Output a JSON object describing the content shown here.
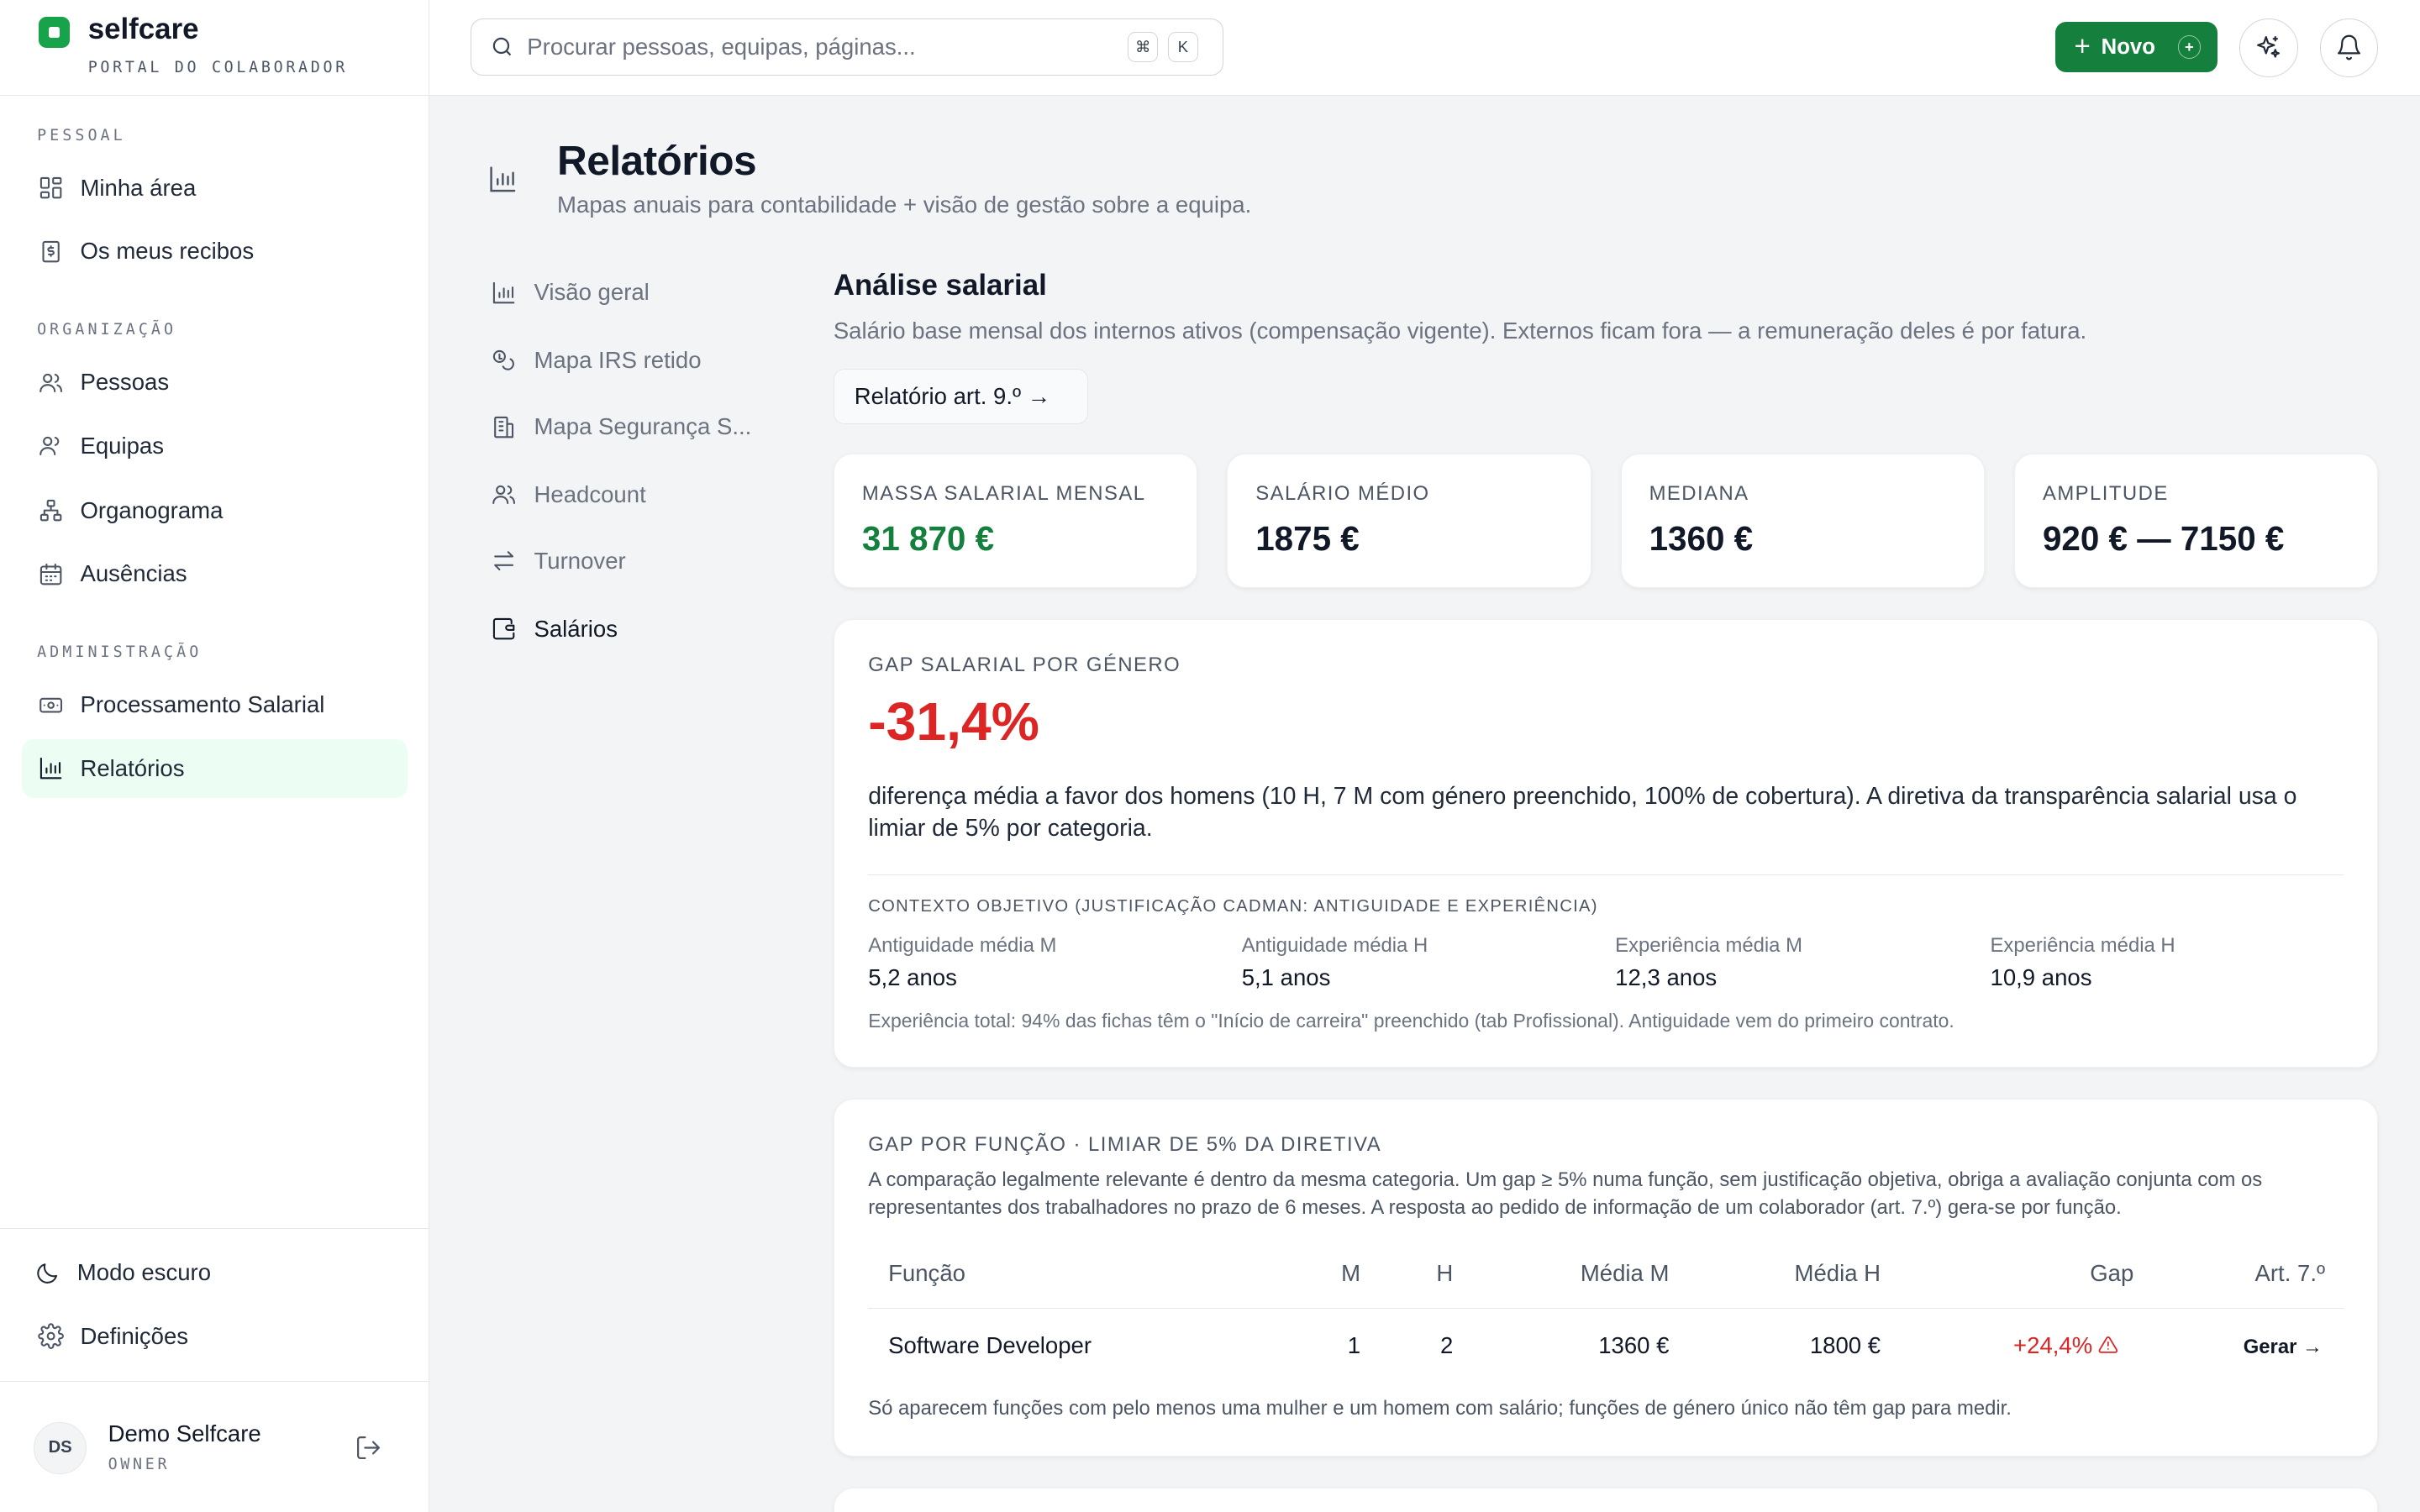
{
  "brand": {
    "name": "selfcare",
    "subtitle": "PORTAL DO COLABORADOR"
  },
  "sidebar": {
    "sections": [
      "PESSOAL",
      "ORGANIZAÇÃO",
      "ADMINISTRAÇÃO"
    ],
    "items": [
      {
        "label": "Minha área",
        "icon": "dashboard-icon"
      },
      {
        "label": "Os meus recibos",
        "icon": "receipt-icon"
      },
      {
        "label": "Pessoas",
        "icon": "people-icon"
      },
      {
        "label": "Equipas",
        "icon": "team-icon"
      },
      {
        "label": "Organograma",
        "icon": "org-chart-icon"
      },
      {
        "label": "Ausências",
        "icon": "calendar-icon"
      },
      {
        "label": "Processamento Salarial",
        "icon": "money-icon"
      },
      {
        "label": "Relatórios",
        "icon": "bar-chart-icon",
        "active": true
      }
    ],
    "bottom": [
      {
        "label": "Modo escuro",
        "icon": "moon-icon"
      },
      {
        "label": "Definições",
        "icon": "gear-icon"
      }
    ],
    "user": {
      "initials": "DS",
      "name": "Demo Selfcare",
      "role": "OWNER"
    }
  },
  "topbar": {
    "search_placeholder": "Procurar pessoas, equipas, páginas...",
    "kbd": [
      "⌘",
      "K"
    ],
    "new_button": "Novo",
    "new_plus": "+",
    "new_badge": "+"
  },
  "page": {
    "title": "Relatórios",
    "subtitle": "Mapas anuais para contabilidade + visão de gestão sobre a equipa."
  },
  "subnav": [
    {
      "label": "Visão geral"
    },
    {
      "label": "Mapa IRS retido"
    },
    {
      "label": "Mapa Segurança S..."
    },
    {
      "label": "Headcount"
    },
    {
      "label": "Turnover"
    },
    {
      "label": "Salários",
      "active": true
    }
  ],
  "analysis": {
    "title": "Análise salarial",
    "subtitle": "Salário base mensal dos internos ativos (compensação vigente). Externos ficam fora — a remuneração deles é por fatura.",
    "art9_button": "Relatório art. 9.º →"
  },
  "stats": [
    {
      "label": "MASSA SALARIAL MENSAL",
      "value": "31 870 €",
      "accent": "#15803d"
    },
    {
      "label": "SALÁRIO MÉDIO",
      "value": "1875 €"
    },
    {
      "label": "MEDIANA",
      "value": "1360 €"
    },
    {
      "label": "AMPLITUDE",
      "value": "920 € — 7150 €"
    }
  ],
  "gender_gap": {
    "label": "GAP SALARIAL POR GÉNERO",
    "value": "-31,4%",
    "description": "diferença média a favor dos homens (10 H, 7 M com género preenchido, 100% de cobertura). A diretiva da transparência salarial usa o limiar de 5% por categoria.",
    "context_label": "CONTEXTO OBJETIVO (JUSTIFICAÇÃO CADMAN: ANTIGUIDADE E EXPERIÊNCIA)",
    "context": [
      {
        "label": "Antiguidade média M",
        "value": "5,2 anos"
      },
      {
        "label": "Antiguidade média H",
        "value": "5,1 anos"
      },
      {
        "label": "Experiência média M",
        "value": "12,3 anos"
      },
      {
        "label": "Experiência média H",
        "value": "10,9 anos"
      }
    ],
    "note": "Experiência total: 94% das fichas têm o \"Início de carreira\" preenchido (tab Profissional). Antiguidade vem do primeiro contrato."
  },
  "function_gap": {
    "label": "GAP POR FUNÇÃO · LIMIAR DE 5% DA DIRETIVA",
    "description": "A comparação legalmente relevante é dentro da mesma categoria. Um gap ≥ 5% numa função, sem justificação objetiva, obriga a avaliação conjunta com os representantes dos trabalhadores no prazo de 6 meses. A resposta ao pedido de informação de um colaborador (art. 7.º) gera-se por função.",
    "columns": [
      "Função",
      "M",
      "H",
      "Média M",
      "Média H",
      "Gap",
      "Art. 7.º"
    ],
    "rows": [
      {
        "funcao": "Software Developer",
        "m": "1",
        "h": "2",
        "media_m": "1360 €",
        "media_h": "1800 €",
        "gap": "+24,4%",
        "action": "Gerar →"
      }
    ],
    "note": "Só aparecem funções com pelo menos uma mulher e um homem com salário; funções de género único não têm gap para medir."
  },
  "colors": {
    "accent": "#15803d",
    "danger": "#dc2626"
  }
}
